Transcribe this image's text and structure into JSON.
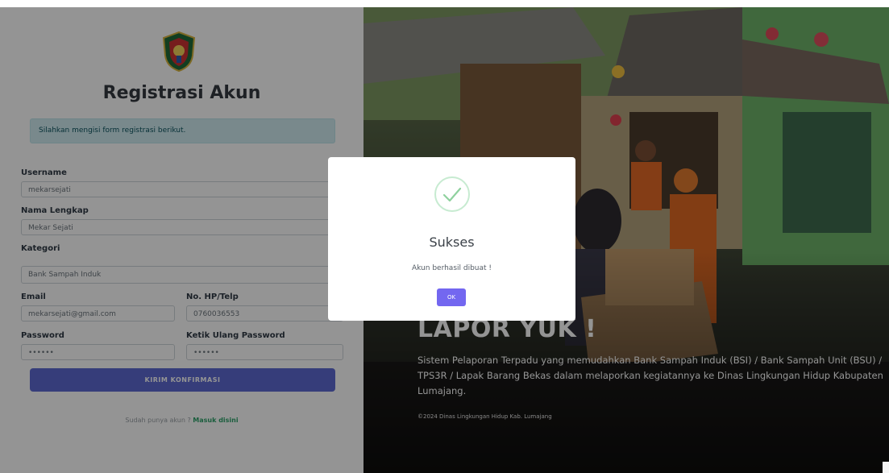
{
  "form": {
    "title": "Registrasi Akun",
    "info_message": "Silahkan mengisi form registrasi berikut.",
    "username": {
      "label": "Username",
      "value": "mekarsejati"
    },
    "fullname": {
      "label": "Nama Lengkap",
      "value": "Mekar Sejati"
    },
    "category": {
      "label": "Kategori",
      "value": "Bank Sampah Induk"
    },
    "email": {
      "label": "Email",
      "value": "mekarsejati@gmail.com"
    },
    "phone": {
      "label": "No. HP/Telp",
      "value": "0760036553"
    },
    "password": {
      "label": "Password",
      "value": "••••••"
    },
    "password_confirm": {
      "label": "Ketik Ulang Password",
      "value": "••••••"
    },
    "submit_label": "KIRIM KONFIRMASI",
    "login_prompt": "Sudah punya akun ?",
    "login_link": "Masuk disini"
  },
  "hero": {
    "title": "LAPOR YUK !",
    "description": "Sistem Pelaporan Terpadu yang memudahkan Bank Sampah Induk (BSI) / Bank Sampah Unit (BSU) / TPS3R / Lapak Barang Bekas dalam melaporkan kegiatannya ke Dinas Lingkungan Hidup Kabupaten Lumajang.",
    "copyright": "©2024 Dinas Lingkungan Hidup Kab. Lumajang"
  },
  "modal": {
    "icon": "success-check-icon",
    "title": "Sukses",
    "message": "Akun berhasil dibuat !",
    "ok_label": "OK"
  },
  "colors": {
    "accent": "#5e6ad2",
    "ok_button": "#7367f0",
    "success": "#8fd19e",
    "alert_bg": "#d1ecf1",
    "link": "#2fa36b"
  }
}
